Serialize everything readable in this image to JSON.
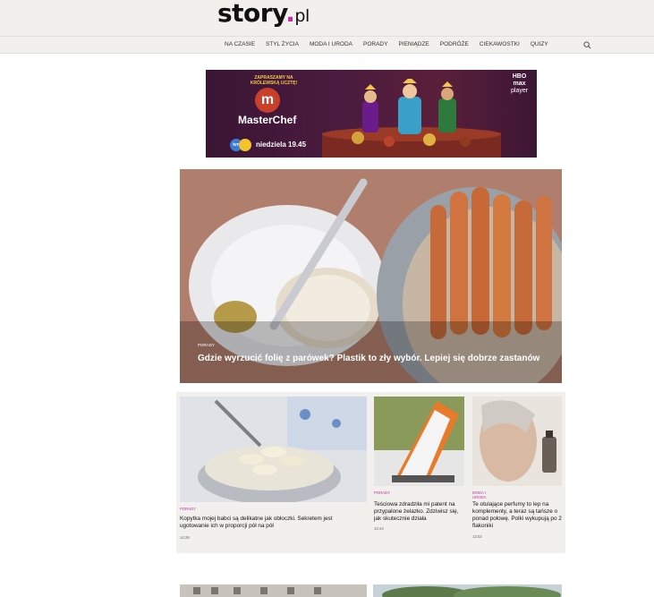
{
  "logo": {
    "main": "story",
    "dot": ".",
    "suffix": "pl"
  },
  "nav": {
    "items": [
      "NA CZASIE",
      "STYL ŻYCIA",
      "MODA I URODA",
      "PORADY",
      "PIENIĄDZE",
      "PODRÓŻE",
      "CIEKAWOSTKI",
      "QUIZY"
    ]
  },
  "ad": {
    "invite": "ZAPRASZAMY NA KRÓLEWSKĄ UCZTĘ!",
    "brand": "MasterChef",
    "channel": "tvn",
    "schedule": "niedziela 19.45",
    "partner_top": "HBO",
    "partner_mid": "max",
    "partner_bottom": "player"
  },
  "hero": {
    "category": "PORADY",
    "title": "Gdzie wyrzucić folię z parówek? Plastik to zły wybór. Lepiej się dobrze zastanów"
  },
  "cards": [
    {
      "category": "PORADY",
      "title": "Kopytka mojej babci są delikatne jak obłoczki. Sekretem jest ugotowanie ich w proporcji pół na pół",
      "time": "14:26"
    },
    {
      "category": "PORADY",
      "title": "Teściowa zdradziła mi patent na przypalone żelazko. Zdziwisz się, jak skutecznie działa",
      "time": "13:44"
    },
    {
      "category": "MODA I URODA",
      "title": "Te otulające perfumy to lep na komplementy, a teraz są tańsze o ponad połowę. Polki wykupują po 2 flakoniki",
      "time": "13:02"
    }
  ],
  "colors": {
    "accent": "#c12fa8",
    "header_bg": "#f1f0ec"
  }
}
